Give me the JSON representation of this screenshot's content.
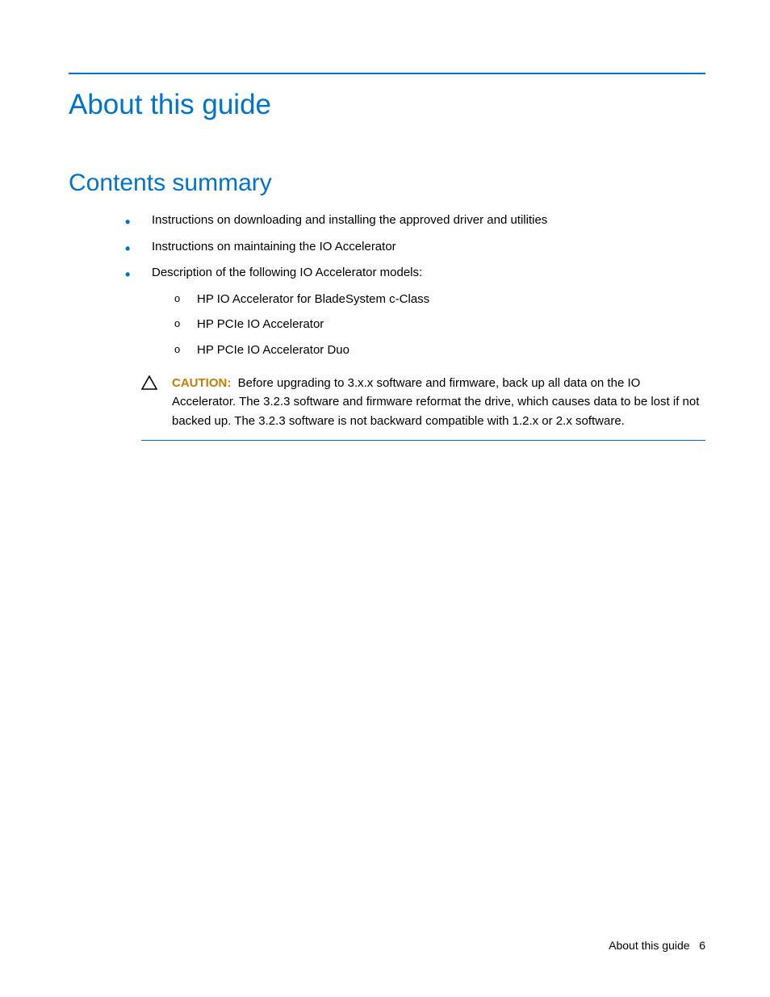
{
  "page_title": "About this guide",
  "section_title": "Contents summary",
  "bullets": [
    {
      "text": "Instructions on downloading and installing the approved driver and utilities"
    },
    {
      "text": "Instructions on maintaining the IO Accelerator"
    },
    {
      "text": "Description of the following IO Accelerator models:",
      "sub": [
        "HP IO Accelerator for BladeSystem c-Class",
        "HP PCIe IO Accelerator",
        "HP PCIe IO Accelerator Duo"
      ]
    }
  ],
  "caution": {
    "label": "CAUTION:",
    "text": "Before upgrading to 3.x.x software and firmware, back up all data on the IO Accelerator. The 3.2.3 software and firmware reformat the drive, which causes data to be lost if not backed up. The 3.2.3 software is not backward compatible with 1.2.x or 2.x software."
  },
  "footer": {
    "section": "About this guide",
    "page_number": "6"
  },
  "colors": {
    "accent": "#0073cf",
    "caution_label": "#c97b00"
  }
}
